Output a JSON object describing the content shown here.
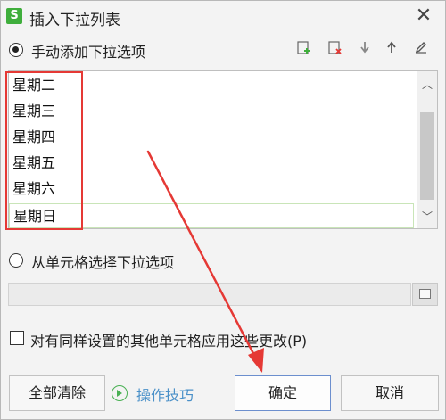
{
  "window": {
    "title": "插入下拉列表",
    "app_icon_letter": "S",
    "close_glyph": "✕"
  },
  "manual": {
    "label": "手动添加下拉选项",
    "checked": true,
    "toolbar_icons": [
      "add-item-icon",
      "delete-item-icon",
      "move-down-icon",
      "move-up-icon",
      "edit-icon"
    ],
    "items": [
      "星期二",
      "星期三",
      "星期四",
      "星期五",
      "星期六",
      "星期日"
    ],
    "selected_item": "星期日"
  },
  "from_cells": {
    "label": "从单元格选择下拉选项",
    "checked": false,
    "range_value": ""
  },
  "apply_all": {
    "label": "对有同样设置的其他单元格应用这些更改(P)",
    "checked": false
  },
  "buttons": {
    "clear_all": "全部清除",
    "tips": "操作技巧",
    "ok": "确定",
    "cancel": "取消"
  },
  "colors": {
    "annotation_red": "#e53935",
    "tips_blue": "#4a90c8",
    "brand_green": "#3fae3c"
  }
}
